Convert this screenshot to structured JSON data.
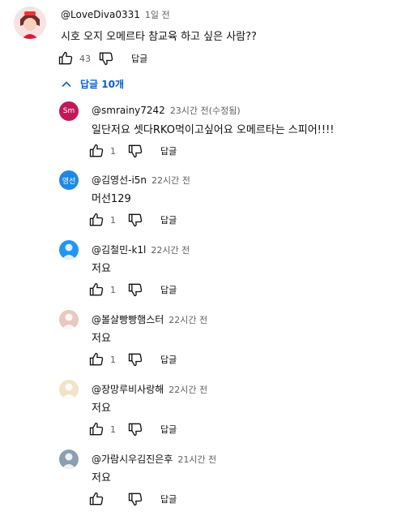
{
  "top_comment": {
    "author": "@LoveDiva0331",
    "time": "1일 전",
    "text": "시호 오지 오메르타 참교육 하고 싶은 사람??",
    "likes": "43",
    "reply_label": "답글"
  },
  "replies_toggle": {
    "label": "답글 10개",
    "icon": "chevron-up-icon"
  },
  "replies": [
    {
      "author": "@smrainy7242",
      "time": "23시간 전(수정됨)",
      "text": "일단저요 셋다RKO먹이고싶어요 오메르타는 스피어!!!!",
      "likes": "1",
      "reply_label": "답글",
      "avatar_text": "Sm",
      "avatar_color": "#c2185b"
    },
    {
      "author": "@김영선-i5n",
      "time": "22시간 전",
      "text": "머선129",
      "likes": "1",
      "reply_label": "답글",
      "avatar_text": "영선",
      "avatar_color": "#1e88e5"
    },
    {
      "author": "@김철민-k1l",
      "time": "22시간 전",
      "text": "저요",
      "likes": "1",
      "reply_label": "답글",
      "avatar_text": "",
      "avatar_color": "#2196f3"
    },
    {
      "author": "@볼살빵빵햄스터",
      "time": "22시간 전",
      "text": "저요",
      "likes": "1",
      "reply_label": "답글",
      "avatar_text": "",
      "avatar_color": "#e8c8c0"
    },
    {
      "author": "@장망루비사랑해",
      "time": "22시간 전",
      "text": "저요",
      "likes": "1",
      "reply_label": "답글",
      "avatar_text": "",
      "avatar_color": "#efe4c8"
    },
    {
      "author": "@가람시우김진은후",
      "time": "21시간 전",
      "text": "저요",
      "likes": "",
      "reply_label": "답글",
      "avatar_text": "",
      "avatar_color": "#8aa0b0"
    }
  ],
  "colors": {
    "link": "#065fd4",
    "secondary_text": "#606060"
  }
}
